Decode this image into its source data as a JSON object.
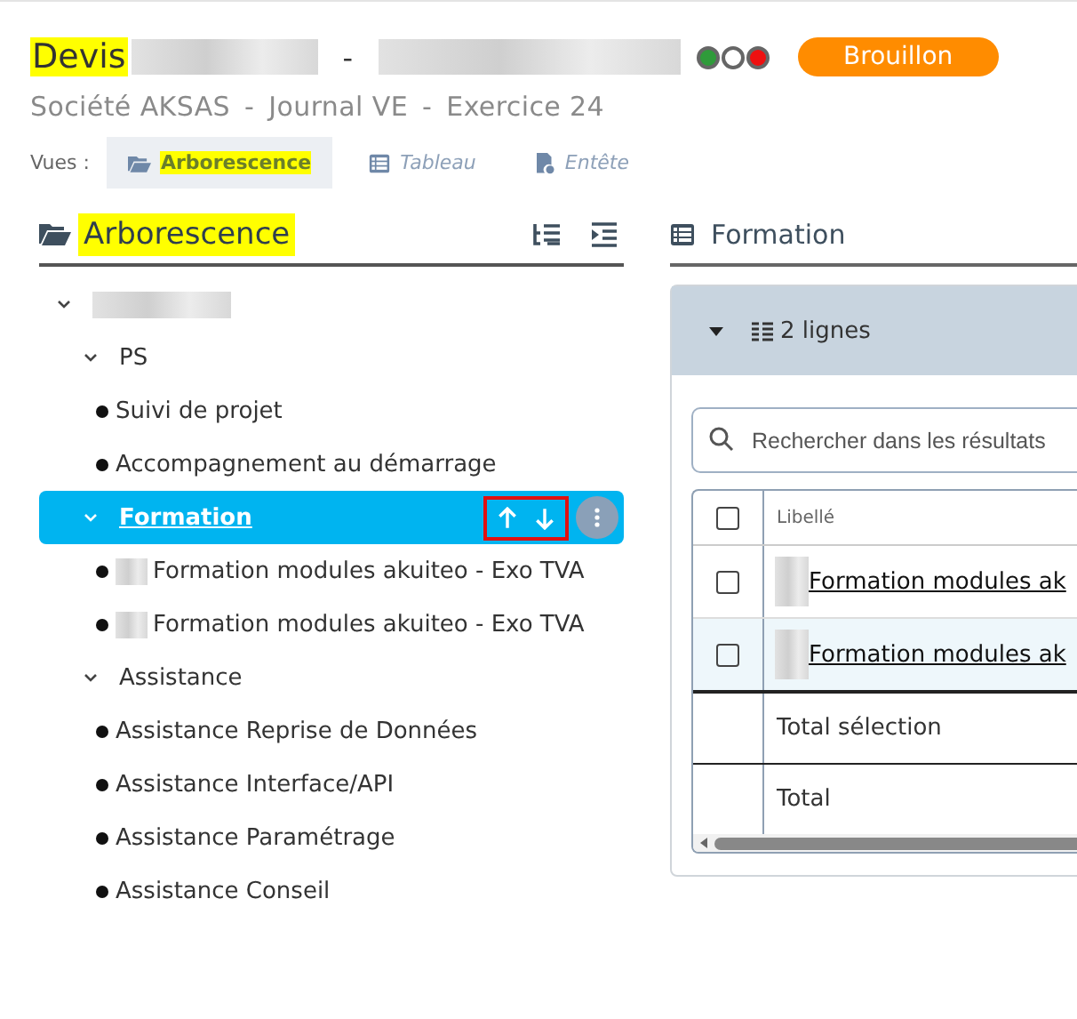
{
  "header": {
    "title": "Devis",
    "title_highlighted": true,
    "separator": "-",
    "status_dots": [
      {
        "color": "#2f9b3a"
      },
      {
        "color": "#ffffff"
      },
      {
        "color": "#ee1010"
      }
    ],
    "badge": "Brouillon",
    "subtitle": [
      "Société AKSAS",
      "-",
      "Journal VE",
      "-",
      "Exercice 24"
    ]
  },
  "views": {
    "label": "Vues :",
    "items": [
      {
        "label": "Arborescence",
        "kind": "folder",
        "selected": true,
        "highlighted": true
      },
      {
        "label": "Tableau",
        "kind": "table",
        "selected": false,
        "highlighted": false
      },
      {
        "label": "Entête",
        "kind": "doc",
        "selected": false,
        "highlighted": false
      }
    ]
  },
  "tree_panel": {
    "title": "Arborescence",
    "highlighted": true,
    "nodes": [
      {
        "kind": "group",
        "expanded": true,
        "selected": false,
        "children": [
          {
            "kind": "group",
            "label": "PS",
            "expanded": true,
            "selected": false,
            "children": [
              {
                "kind": "leaf",
                "label": "Suivi de projet",
                "selected": false
              },
              {
                "kind": "leaf",
                "label": "Accompagnement au démarrage",
                "selected": false
              }
            ]
          },
          {
            "kind": "group",
            "label": "Formation",
            "expanded": true,
            "selected": true,
            "move_outlined": true,
            "children": [
              {
                "kind": "leaf",
                "label": "Formation modules akuiteo - Exo TVA",
                "redacted_prefix": true,
                "selected": false
              },
              {
                "kind": "leaf",
                "label": "Formation modules akuiteo - Exo TVA",
                "redacted_prefix": true,
                "selected": false
              }
            ]
          },
          {
            "kind": "group",
            "label": "Assistance",
            "expanded": true,
            "selected": false,
            "children": [
              {
                "kind": "leaf",
                "label": "Assistance Reprise de Données",
                "selected": false
              },
              {
                "kind": "leaf",
                "label": "Assistance Interface/API",
                "selected": false
              },
              {
                "kind": "leaf",
                "label": "Assistance Paramétrage",
                "selected": false
              },
              {
                "kind": "leaf",
                "label": "Assistance Conseil",
                "selected": false
              }
            ]
          }
        ]
      }
    ]
  },
  "detail_panel": {
    "title": "Formation",
    "row_count": "2 lignes",
    "search": {
      "placeholder": "Rechercher dans les résultats"
    },
    "select_all_checked": false,
    "columns": [
      "Libellé"
    ],
    "rows": [
      {
        "label": "Formation modules ak",
        "checked": false,
        "highlighted": false
      },
      {
        "label": "Formation modules ak",
        "checked": false,
        "highlighted": true
      }
    ],
    "totals": [
      "Total sélection",
      "Total"
    ]
  }
}
